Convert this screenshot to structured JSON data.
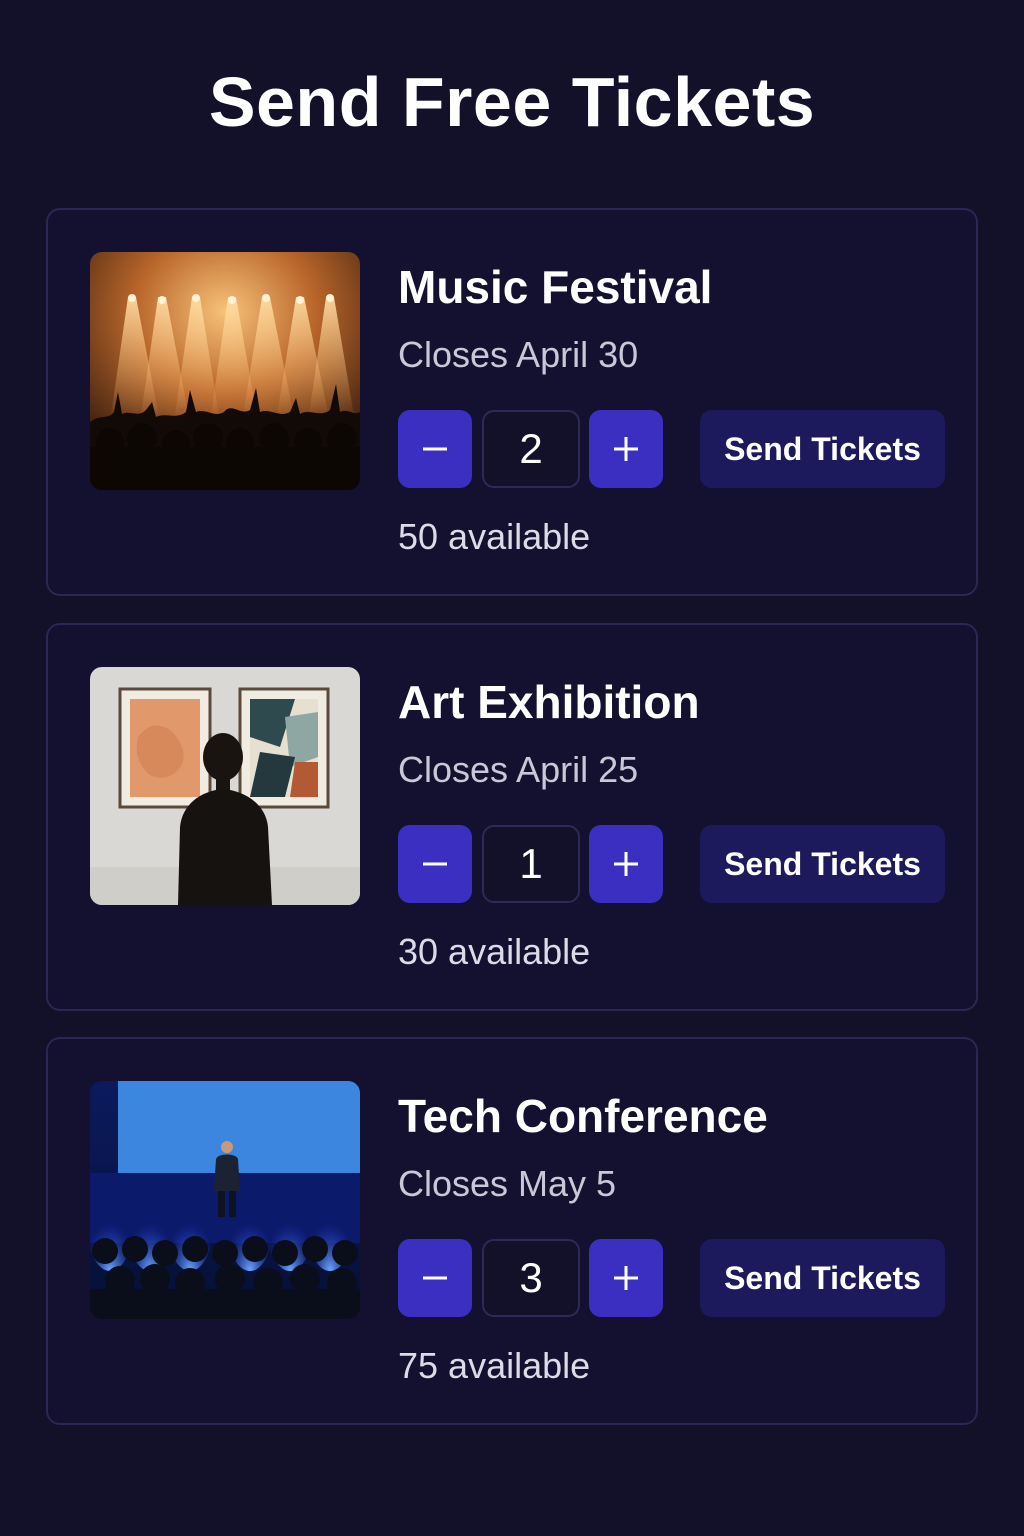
{
  "page": {
    "title": "Send Free Tickets",
    "colors": {
      "background": "#13102a",
      "card_border": "#2a2752",
      "stepper_button": "#3a2fc1",
      "send_button": "#1c1a5c",
      "secondary_text": "#c9c8d8"
    }
  },
  "events": [
    {
      "title": "Music Festival",
      "closes": "Closes April 30",
      "quantity": "2",
      "send_label": "Send Tickets",
      "available": "50 available",
      "image_alt": "Concert crowd with stage lights"
    },
    {
      "title": "Art Exhibition",
      "closes": "Closes April 25",
      "quantity": "1",
      "send_label": "Send Tickets",
      "available": "30 available",
      "image_alt": "Person viewing framed artworks on a gallery wall"
    },
    {
      "title": "Tech Conference",
      "closes": "Closes May 5",
      "quantity": "3",
      "send_label": "Send Tickets",
      "available": "75 available",
      "image_alt": "Speaker on a stage with blue screen and audience"
    }
  ],
  "icons": {
    "decrement": "minus-icon",
    "increment": "plus-icon"
  }
}
